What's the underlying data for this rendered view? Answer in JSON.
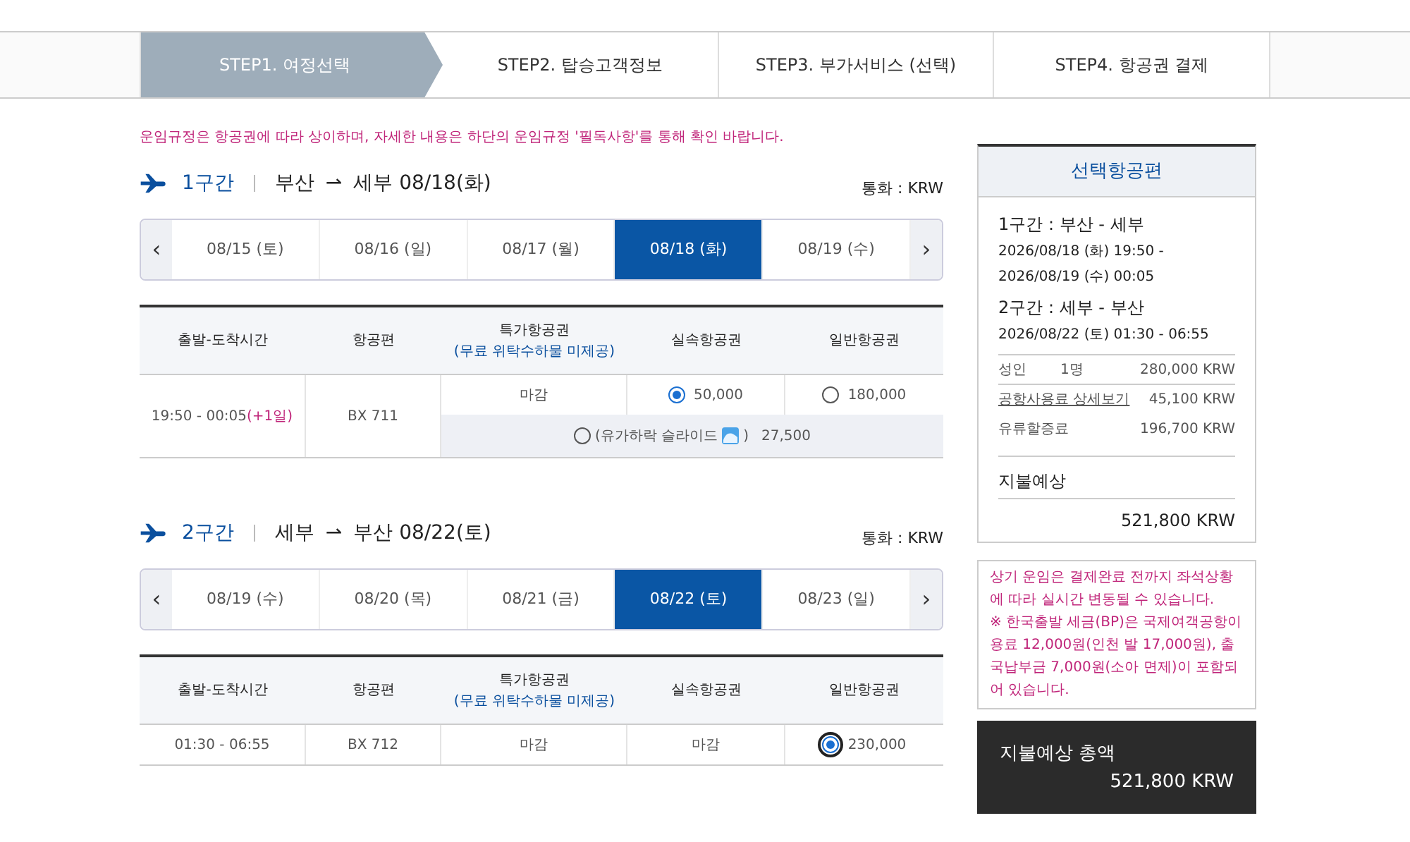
{
  "steps": [
    {
      "label": "STEP1. 여정선택",
      "selected": true
    },
    {
      "label": "STEP2. 탑승고객정보",
      "selected": false
    },
    {
      "label": "STEP3. 부가서비스 (선택)",
      "selected": false
    },
    {
      "label": "STEP4. 항공권 결제",
      "selected": false
    }
  ],
  "notice": "운임규정은 항공권에 따라 상이하며, 자세한 내용은 하단의 운임규정 '필독사항'를 통해 확인 바랍니다.",
  "segments": [
    {
      "name": "1구간",
      "route_from": "부산",
      "arrow": "⇀",
      "route_to": "세부 08/18(화)",
      "currency": "통화 : KRW",
      "prev": "‹",
      "next": "›",
      "dates": [
        {
          "label": "08/15 (토)",
          "selected": false
        },
        {
          "label": "08/16 (일)",
          "selected": false
        },
        {
          "label": "08/17 (월)",
          "selected": false
        },
        {
          "label": "08/18 (화)",
          "selected": true
        },
        {
          "label": "08/19 (수)",
          "selected": false
        }
      ],
      "columns": [
        "출발-도착시간",
        "항공편",
        "특가항공권",
        "실속항공권",
        "일반항공권"
      ],
      "column_note": "(무료 위탁수하물 미제공)",
      "rows": [
        {
          "time": "19:50 - 00:05",
          "time_extra": "(+1일)",
          "flight": "BX 711",
          "fares": [
            {
              "kind": "closed",
              "label": "마감"
            },
            {
              "kind": "radio",
              "selected": true,
              "price": "50,000"
            },
            {
              "kind": "radio",
              "selected": false,
              "price": "180,000"
            }
          ],
          "extra": {
            "selected": false,
            "label": "(유가하락 슬라이드",
            "label_end": ")",
            "price": "27,500"
          }
        }
      ]
    },
    {
      "name": "2구간",
      "route_from": "세부",
      "arrow": "⇀",
      "route_to": "부산 08/22(토)",
      "currency": "통화 : KRW",
      "prev": "‹",
      "next": "›",
      "dates": [
        {
          "label": "08/19 (수)",
          "selected": false
        },
        {
          "label": "08/20 (목)",
          "selected": false
        },
        {
          "label": "08/21 (금)",
          "selected": false
        },
        {
          "label": "08/22 (토)",
          "selected": true
        },
        {
          "label": "08/23 (일)",
          "selected": false
        }
      ],
      "columns": [
        "출발-도착시간",
        "항공편",
        "특가항공권",
        "실속항공권",
        "일반항공권"
      ],
      "column_note": "(무료 위탁수하물 미제공)",
      "rows": [
        {
          "time": "01:30 - 06:55",
          "flight": "BX 712",
          "fares": [
            {
              "kind": "closed",
              "label": "마감"
            },
            {
              "kind": "closed",
              "label": "마감"
            },
            {
              "kind": "radio",
              "selected": true,
              "price": "230,000"
            }
          ]
        }
      ]
    }
  ],
  "summary": {
    "title": "선택항공편",
    "legs": [
      {
        "title": "1구간 : 부산 - 세부",
        "lines": [
          "2026/08/18 (화) 19:50 -",
          "2026/08/19 (수) 00:05"
        ]
      },
      {
        "title": "2구간 : 세부 - 부산",
        "lines": [
          "2026/08/22 (토) 01:30 - 06:55"
        ]
      }
    ],
    "fees": [
      {
        "kind": "passenger",
        "label": "성인",
        "count": "1명",
        "amount": "280,000 KRW"
      },
      {
        "kind": "link",
        "label": "공항사용료 상세보기",
        "amount": "45,100 KRW"
      },
      {
        "kind": "text",
        "label": "유류할증료",
        "amount": "196,700 KRW"
      }
    ],
    "estimate_label": "지불예상",
    "estimate_amount": "521,800 KRW"
  },
  "warning": "상기 운임은 결제완료 전까지 좌석상황에 따라 실시간 변동될 수 있습니다.\n※ 한국출발 세금(BP)은 국제여객공항이용료 12,000원(인천 발 17,000원), 출국납부금 7,000원(소아 면제)이 포함되어 있습니다.",
  "total": {
    "label": "지불예상 총액",
    "amount": "521,800 KRW"
  }
}
